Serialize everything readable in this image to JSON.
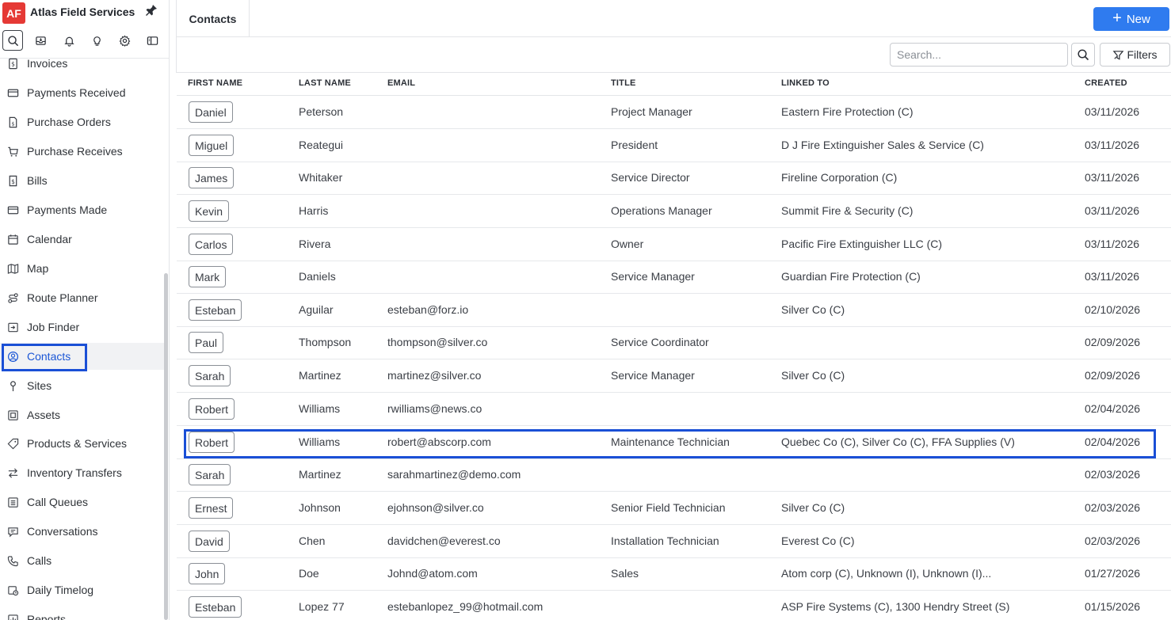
{
  "brand": {
    "logo": "AF",
    "name": "Atlas Field Services"
  },
  "toolbar": {
    "icons": [
      "search-icon",
      "inbox-icon",
      "bell-icon",
      "lightbulb-icon",
      "gear-icon",
      "panel-icon"
    ]
  },
  "sidebar": {
    "items": [
      {
        "label": "Invoices",
        "icon": "invoice-icon"
      },
      {
        "label": "Payments Received",
        "icon": "card-icon"
      },
      {
        "label": "Purchase Orders",
        "icon": "document-icon"
      },
      {
        "label": "Purchase Receives",
        "icon": "cart-icon"
      },
      {
        "label": "Bills",
        "icon": "bill-icon"
      },
      {
        "label": "Payments Made",
        "icon": "card-icon"
      },
      {
        "label": "Calendar",
        "icon": "calendar-icon"
      },
      {
        "label": "Map",
        "icon": "map-icon"
      },
      {
        "label": "Route Planner",
        "icon": "route-icon"
      },
      {
        "label": "Job Finder",
        "icon": "job-finder-icon"
      },
      {
        "label": "Contacts",
        "icon": "contact-icon",
        "selected": true
      },
      {
        "label": "Sites",
        "icon": "pin-location-icon"
      },
      {
        "label": "Assets",
        "icon": "asset-icon"
      },
      {
        "label": "Products & Services",
        "icon": "tag-icon"
      },
      {
        "label": "Inventory Transfers",
        "icon": "transfer-icon"
      },
      {
        "label": "Call Queues",
        "icon": "queue-icon"
      },
      {
        "label": "Conversations",
        "icon": "chat-icon"
      },
      {
        "label": "Calls",
        "icon": "phone-icon"
      },
      {
        "label": "Daily Timelog",
        "icon": "timelog-icon"
      },
      {
        "label": "Reports",
        "icon": "reports-icon"
      }
    ]
  },
  "header": {
    "tab": "Contacts",
    "new_label": "New"
  },
  "filters": {
    "search_placeholder": "Search...",
    "filters_label": "Filters"
  },
  "table": {
    "columns": [
      "FIRST NAME",
      "LAST NAME",
      "EMAIL",
      "TITLE",
      "LINKED TO",
      "CREATED"
    ],
    "rows": [
      {
        "first": "Daniel",
        "last": "Peterson",
        "email": "",
        "title": "Project Manager",
        "linked": "Eastern Fire Protection (C)",
        "created": "03/11/2026"
      },
      {
        "first": "Miguel",
        "last": "Reategui",
        "email": "",
        "title": "President",
        "linked": "D J Fire Extinguisher Sales & Service (C)",
        "created": "03/11/2026"
      },
      {
        "first": "James",
        "last": "Whitaker",
        "email": "",
        "title": "Service Director",
        "linked": "Fireline Corporation (C)",
        "created": "03/11/2026"
      },
      {
        "first": "Kevin",
        "last": "Harris",
        "email": "",
        "title": "Operations Manager",
        "linked": "Summit Fire & Security (C)",
        "created": "03/11/2026"
      },
      {
        "first": "Carlos",
        "last": "Rivera",
        "email": "",
        "title": "Owner",
        "linked": "Pacific Fire Extinguisher LLC (C)",
        "created": "03/11/2026"
      },
      {
        "first": "Mark",
        "last": "Daniels",
        "email": "",
        "title": "Service Manager",
        "linked": "Guardian Fire Protection (C)",
        "created": "03/11/2026"
      },
      {
        "first": "Esteban",
        "last": "Aguilar",
        "email": "esteban@forz.io",
        "title": "",
        "linked": "Silver Co (C)",
        "created": "02/10/2026"
      },
      {
        "first": "Paul",
        "last": "Thompson",
        "email": "thompson@silver.co",
        "title": "Service Coordinator",
        "linked": "",
        "created": "02/09/2026"
      },
      {
        "first": "Sarah",
        "last": "Martinez",
        "email": "martinez@silver.co",
        "title": "Service Manager",
        "linked": "Silver Co (C)",
        "created": "02/09/2026"
      },
      {
        "first": "Robert",
        "last": "Williams",
        "email": "rwilliams@news.co",
        "title": "",
        "linked": "",
        "created": "02/04/2026"
      },
      {
        "first": "Robert",
        "last": "Williams",
        "email": "robert@abscorp.com",
        "title": "Maintenance Technician",
        "linked": "Quebec Co (C), Silver Co (C), FFA Supplies (V)",
        "created": "02/04/2026"
      },
      {
        "first": "Sarah",
        "last": "Martinez",
        "email": "sarahmartinez@demo.com",
        "title": "",
        "linked": "",
        "created": "02/03/2026"
      },
      {
        "first": "Ernest",
        "last": "Johnson",
        "email": "ejohnson@silver.co",
        "title": "Senior Field Technician",
        "linked": "Silver Co (C)",
        "created": "02/03/2026"
      },
      {
        "first": "David",
        "last": "Chen",
        "email": "davidchen@everest.co",
        "title": "Installation Technician",
        "linked": "Everest Co (C)",
        "created": "02/03/2026"
      },
      {
        "first": "John",
        "last": "Doe",
        "email": "Johnd@atom.com",
        "title": "Sales",
        "linked": "Atom corp (C), Unknown (I), Unknown (I)...",
        "created": "01/27/2026"
      },
      {
        "first": "Esteban",
        "last": "Lopez 77",
        "email": "estebanlopez_99@hotmail.com",
        "title": "",
        "linked": "ASP Fire Systems (C), 1300 Hendry Street (S)",
        "created": "01/15/2026"
      }
    ]
  },
  "colors": {
    "accent": "#2f7bef",
    "highlight": "#1a4fd6",
    "brand": "#e53935"
  }
}
